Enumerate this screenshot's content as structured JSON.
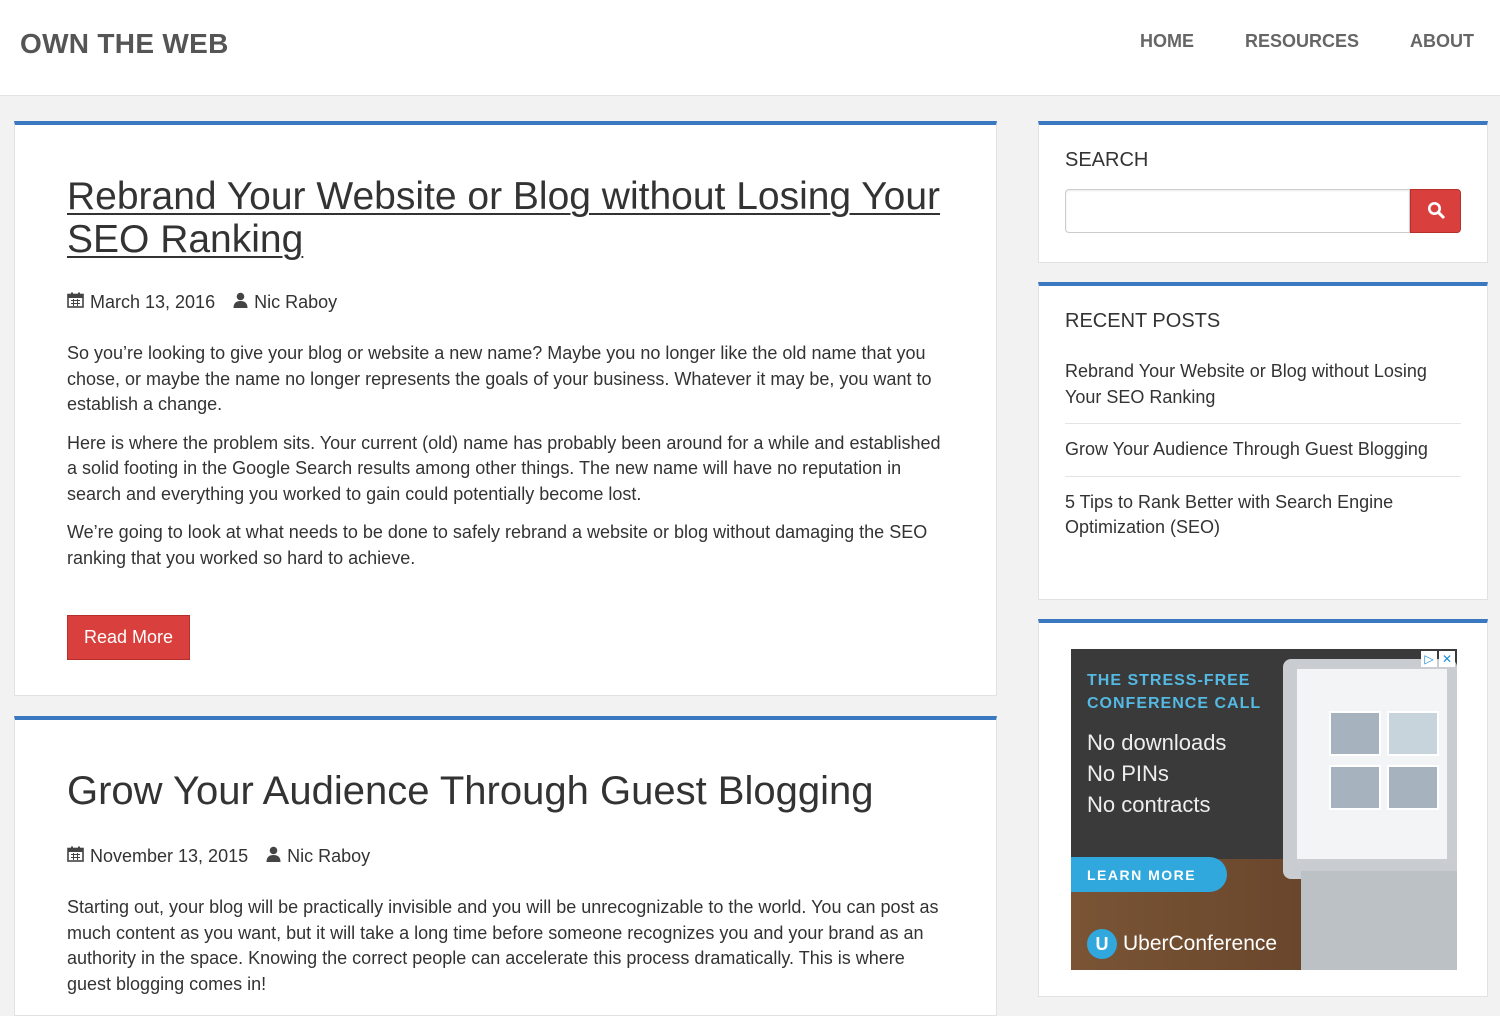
{
  "header": {
    "brand": "OWN THE WEB",
    "nav": [
      "HOME",
      "RESOURCES",
      "ABOUT"
    ]
  },
  "posts": [
    {
      "title": "Rebrand Your Website or Blog without Losing Your SEO Ranking",
      "date": "March 13, 2016",
      "author": "Nic Raboy",
      "paragraphs": [
        "So you’re looking to give your blog or website a new name? Maybe you no longer like the old name that you chose, or maybe the name no longer represents the goals of your business. Whatever it may be, you want to establish a change.",
        "Here is where the problem sits. Your current (old) name has probably been around for a while and established a solid footing in the Google Search results among other things. The new name will have no reputation in search and everything you worked to gain could potentially become lost.",
        "We’re going to look at what needs to be done to safely rebrand a website or blog without damaging the SEO ranking that you worked so hard to achieve."
      ],
      "read_more": "Read More"
    },
    {
      "title": "Grow Your Audience Through Guest Blogging",
      "date": "November 13, 2015",
      "author": "Nic Raboy",
      "paragraphs": [
        "Starting out, your blog will be practically invisible and you will be unrecognizable to the world. You can post as much content as you want, but it will take a long time before someone recognizes you and your brand as an authority in the space. Knowing the correct people can accelerate this process dramatically. This is where guest blogging comes in!"
      ]
    }
  ],
  "sidebar": {
    "search": {
      "title": "SEARCH",
      "placeholder": ""
    },
    "recent": {
      "title": "RECENT POSTS",
      "items": [
        "Rebrand Your Website or Blog without Losing Your SEO Ranking",
        "Grow Your Audience Through Guest Blogging",
        "5 Tips to Rank Better with Search Engine Optimization (SEO)"
      ]
    },
    "ad": {
      "headline_1": "THE STRESS-FREE",
      "headline_2": "CONFERENCE CALL",
      "lines": [
        "No downloads",
        "No PINs",
        "No contracts"
      ],
      "cta": "LEARN MORE",
      "brand": "UberConference"
    }
  },
  "colors": {
    "accent_border": "#3a78c2",
    "button_red": "#d9403d",
    "ad_blue": "#30a8dd"
  }
}
